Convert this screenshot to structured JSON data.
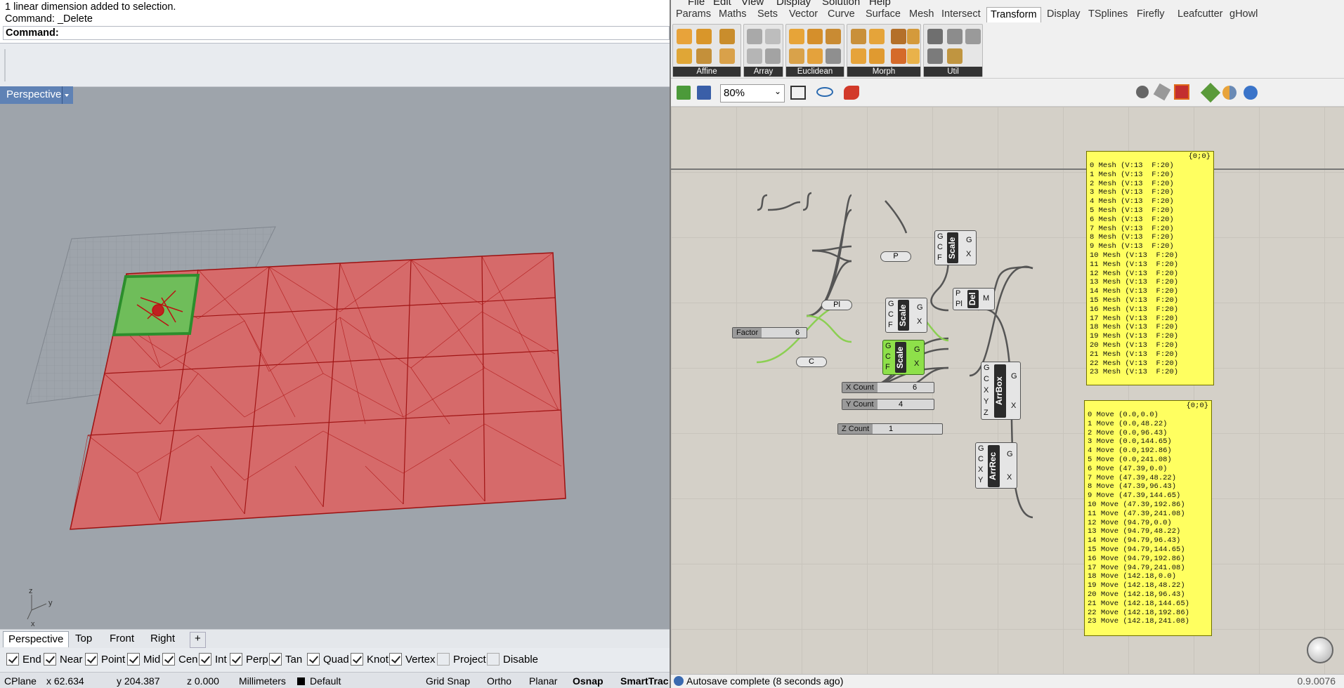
{
  "command_history": {
    "line1": "1 linear dimension added to selection.",
    "line2": "Command: _Delete",
    "prompt": "Command:"
  },
  "viewport": {
    "title": "Perspective",
    "axis_z": "z",
    "axis_y": "y",
    "axis_x": "x"
  },
  "viewport_tabs": [
    "Perspective",
    "Top",
    "Front",
    "Right"
  ],
  "osnaps": [
    {
      "label": "End",
      "on": true
    },
    {
      "label": "Near",
      "on": true
    },
    {
      "label": "Point",
      "on": true
    },
    {
      "label": "Mid",
      "on": true
    },
    {
      "label": "Cen",
      "on": true
    },
    {
      "label": "Int",
      "on": true
    },
    {
      "label": "Perp",
      "on": true
    },
    {
      "label": "Tan",
      "on": true
    },
    {
      "label": "Quad",
      "on": true
    },
    {
      "label": "Knot",
      "on": true
    },
    {
      "label": "Vertex",
      "on": true
    },
    {
      "label": "Project",
      "on": false
    },
    {
      "label": "Disable",
      "on": false
    }
  ],
  "status": {
    "cplane": "CPlane",
    "x": "x 62.634",
    "y": "y 204.387",
    "z": "z 0.000",
    "units": "Millimeters",
    "layer": "Default",
    "grid_snap": "Grid Snap",
    "ortho": "Ortho",
    "planar": "Planar",
    "osnap": "Osnap",
    "smarttrack": "SmartTrac"
  },
  "gh_menu": [
    "File",
    "Edit",
    "View",
    "Display",
    "Solution",
    "Help"
  ],
  "gh_tabs": [
    "Params",
    "Maths",
    "Sets",
    "Vector",
    "Curve",
    "Surface",
    "Mesh",
    "Intersect",
    "Transform",
    "Display",
    "TSplines",
    "Firefly",
    "Leafcutter",
    "gHowl"
  ],
  "gh_active_tab": "Transform",
  "ribbon_groups": [
    "Affine",
    "Array",
    "Euclidean",
    "Morph",
    "Util"
  ],
  "gh_zoom": "80%",
  "gh_status": "Autosave complete (8 seconds ago)",
  "gh_version": "0.9.0076",
  "components": {
    "scale1": {
      "name": "Scale",
      "inputs": [
        "G",
        "C",
        "F"
      ],
      "outputs": [
        "G",
        "X"
      ]
    },
    "scale2": {
      "name": "Scale",
      "inputs": [
        "G",
        "C",
        "F"
      ],
      "outputs": [
        "G",
        "X"
      ]
    },
    "scale3": {
      "name": "Scale",
      "inputs": [
        "G",
        "C",
        "F"
      ],
      "outputs": [
        "G",
        "X"
      ]
    },
    "del": {
      "name": "Del",
      "inputs": [
        "P",
        "Pl"
      ],
      "outputs": [
        "M"
      ]
    },
    "arrbox": {
      "name": "ArrBox",
      "inputs": [
        "G",
        "C",
        "X",
        "Y",
        "Z"
      ],
      "outputs": [
        "G",
        "X"
      ]
    },
    "arrrec": {
      "name": "ArrRec",
      "inputs": [
        "G",
        "C",
        "X",
        "Y"
      ],
      "outputs": [
        "G",
        "X"
      ]
    },
    "param_p": "P",
    "param_pl": "Pl",
    "param_c": "C"
  },
  "sliders": [
    {
      "label": "Factor",
      "value": "6"
    },
    {
      "label": "X Count",
      "value": "6"
    },
    {
      "label": "Y Count",
      "value": "4"
    },
    {
      "label": "Z Count",
      "value": "1"
    }
  ],
  "panel_mesh": {
    "header": "{0;0}",
    "rows": [
      "0 Mesh (V:13  F:20)",
      "1 Mesh (V:13  F:20)",
      "2 Mesh (V:13  F:20)",
      "3 Mesh (V:13  F:20)",
      "4 Mesh (V:13  F:20)",
      "5 Mesh (V:13  F:20)",
      "6 Mesh (V:13  F:20)",
      "7 Mesh (V:13  F:20)",
      "8 Mesh (V:13  F:20)",
      "9 Mesh (V:13  F:20)",
      "10 Mesh (V:13  F:20)",
      "11 Mesh (V:13  F:20)",
      "12 Mesh (V:13  F:20)",
      "13 Mesh (V:13  F:20)",
      "14 Mesh (V:13  F:20)",
      "15 Mesh (V:13  F:20)",
      "16 Mesh (V:13  F:20)",
      "17 Mesh (V:13  F:20)",
      "18 Mesh (V:13  F:20)",
      "19 Mesh (V:13  F:20)",
      "20 Mesh (V:13  F:20)",
      "21 Mesh (V:13  F:20)",
      "22 Mesh (V:13  F:20)",
      "23 Mesh (V:13  F:20)"
    ]
  },
  "panel_move": {
    "header": "{0;0}",
    "rows": [
      "0 Move (0.0,0.0)",
      "1 Move (0.0,48.22)",
      "2 Move (0.0,96.43)",
      "3 Move (0.0,144.65)",
      "4 Move (0.0,192.86)",
      "5 Move (0.0,241.08)",
      "6 Move (47.39,0.0)",
      "7 Move (47.39,48.22)",
      "8 Move (47.39,96.43)",
      "9 Move (47.39,144.65)",
      "10 Move (47.39,192.86)",
      "11 Move (47.39,241.08)",
      "12 Move (94.79,0.0)",
      "13 Move (94.79,48.22)",
      "14 Move (94.79,96.43)",
      "15 Move (94.79,144.65)",
      "16 Move (94.79,192.86)",
      "17 Move (94.79,241.08)",
      "18 Move (142.18,0.0)",
      "19 Move (142.18,48.22)",
      "20 Move (142.18,96.43)",
      "21 Move (142.18,144.65)",
      "22 Move (142.18,192.86)",
      "23 Move (142.18,241.08)"
    ]
  },
  "colors": {
    "mesh_red": "#c83c3c",
    "selection_green": "#3ba23b",
    "panel_yellow": "#ffff60",
    "component_active": "#8ee04a"
  }
}
